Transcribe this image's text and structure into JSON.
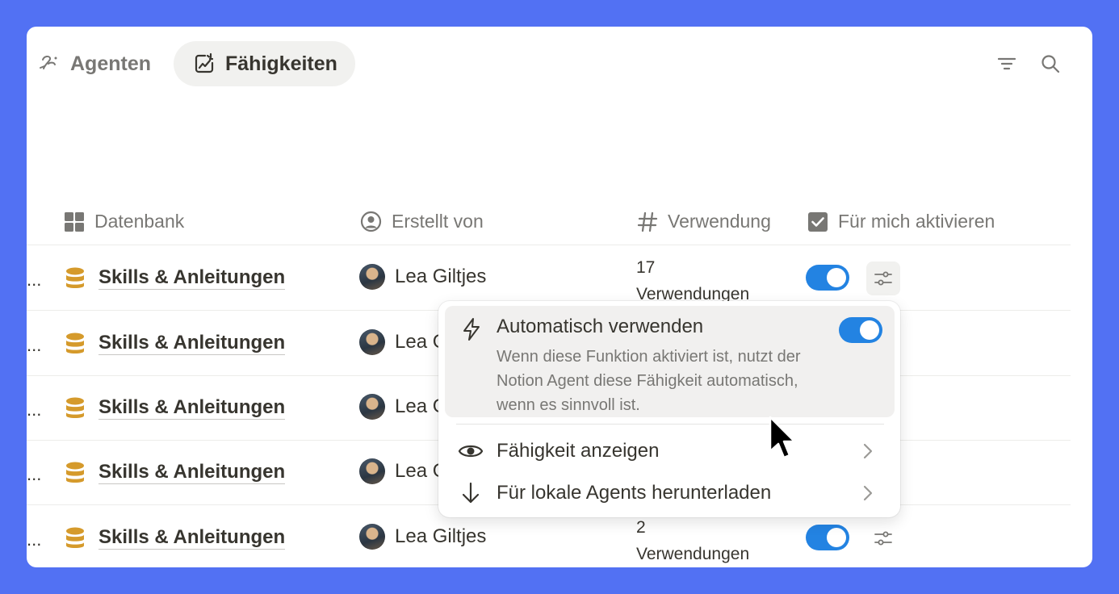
{
  "tabs": [
    {
      "label": "Agenten",
      "active": false
    },
    {
      "label": "Fähigkeiten",
      "active": true
    }
  ],
  "columns": {
    "database": "Datenbank",
    "created_by": "Erstellt von",
    "usage": "Verwendung",
    "activate": "Für mich aktivieren"
  },
  "rows": [
    {
      "truncated": "...",
      "database": "Skills & Anleitungen",
      "creator": "Lea Giltjes",
      "usage_count": "17",
      "usage_unit": "Verwendungen",
      "enabled": true
    },
    {
      "truncated": "...",
      "database": "Skills & Anleitungen",
      "creator": "Lea G",
      "usage_count": "",
      "usage_unit": "",
      "enabled": true
    },
    {
      "truncated": "...",
      "database": "Skills & Anleitungen",
      "creator": "Lea G",
      "usage_count": "",
      "usage_unit": "",
      "enabled": true
    },
    {
      "truncated": "...",
      "database": "Skills & Anleitungen",
      "creator": "Lea G",
      "usage_count": "",
      "usage_unit": "",
      "enabled": true
    },
    {
      "truncated": "...",
      "database": "Skills & Anleitungen",
      "creator": "Lea Giltjes",
      "usage_count": "2",
      "usage_unit": "Verwendungen",
      "enabled": true
    }
  ],
  "menu": {
    "auto_title": "Automatisch verwenden",
    "auto_desc": "Wenn diese Funktion aktiviert ist, nutzt der Notion Agent diese Fähigkeit automatisch, wenn es sinnvoll ist.",
    "auto_enabled": true,
    "items": [
      {
        "label": "Fähigkeit anzeigen",
        "icon": "eye-icon"
      },
      {
        "label": "Für lokale Agents herunterladen",
        "icon": "arrow-down-icon"
      }
    ]
  },
  "colors": {
    "background": "#5271f3",
    "accent": "#2383e2",
    "database_icon": "#d59a2b"
  }
}
